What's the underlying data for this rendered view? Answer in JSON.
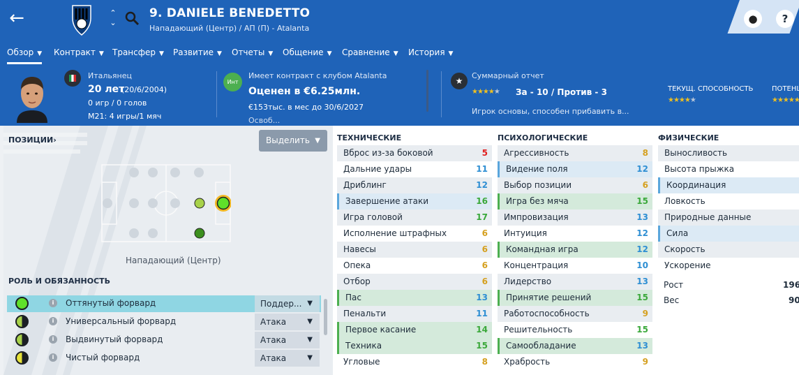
{
  "header": {
    "title": "9. DANIELE BENEDETTO",
    "subtitle": "Нападающий (Центр) / АП (П) - Atalanta",
    "help_label": "?"
  },
  "nav": {
    "tabs": [
      {
        "label": "Обзор",
        "active": true
      },
      {
        "label": "Контракт"
      },
      {
        "label": "Трансфер"
      },
      {
        "label": "Развитие"
      },
      {
        "label": "Отчеты"
      },
      {
        "label": "Общение"
      },
      {
        "label": "Сравнение"
      },
      {
        "label": "История"
      }
    ]
  },
  "info": {
    "nationality": "Итальянец",
    "age": "20 лет",
    "birth": "(20/6/2004)",
    "career": "0 игр / 0 голов",
    "youth": "M21: 4 игры/1 мяч",
    "contract_label": "Имеет контракт с клубом Atalanta",
    "badge": "Инт",
    "value": "Оценен в €6.25млн.",
    "wage": "€153тыс. в мес до 30/6/2027",
    "wage_more": "Освоб...",
    "report_title": "Суммарный отчет",
    "report_score": "За - 10 / Против - 3",
    "report_stars": 3.5,
    "report_summary": "Игрок основы, способен прибавить в...",
    "current_ability_label": "ТЕКУЩ. СПОСОБНОСТЬ",
    "current_ability_stars": 3.5,
    "potential_label": "ПОТЕНЦ",
    "potential_stars": 5
  },
  "left": {
    "positions_label": "ПОЗИЦИИ",
    "select_label": "Выделить",
    "position_name": "Нападающий (Центр)",
    "roles_label": "РОЛЬ И ОБЯЗАННОСТЬ",
    "roles": [
      {
        "name": "Оттянутый форвард",
        "duty": "Поддер...",
        "selected": true,
        "fill": "full"
      },
      {
        "name": "Универсальный форвард",
        "duty": "Атака",
        "fill": "half"
      },
      {
        "name": "Выдвинутый форвард",
        "duty": "Атака",
        "fill": "half"
      },
      {
        "name": "Чистый форвард",
        "duty": "Атака",
        "fill": "half-yellow"
      }
    ]
  },
  "attributes": {
    "technical_label": "ТЕХНИЧЕСКИЕ",
    "mental_label": "ПСИХОЛОГИЧЕСКИЕ",
    "physical_label": "ФИЗИЧЕСКИЕ",
    "technical": [
      {
        "name": "Вброс из-за боковой",
        "value": "5",
        "color": "red"
      },
      {
        "name": "Дальние удары",
        "value": "11",
        "color": "blue"
      },
      {
        "name": "Дриблинг",
        "value": "12",
        "color": "blue"
      },
      {
        "name": "Завершение атаки",
        "value": "16",
        "color": "green",
        "hl": "blue"
      },
      {
        "name": "Игра головой",
        "value": "17",
        "color": "green"
      },
      {
        "name": "Исполнение штрафных",
        "value": "6",
        "color": "orange"
      },
      {
        "name": "Навесы",
        "value": "6",
        "color": "orange"
      },
      {
        "name": "Опека",
        "value": "6",
        "color": "orange"
      },
      {
        "name": "Отбор",
        "value": "6",
        "color": "orange"
      },
      {
        "name": "Пас",
        "value": "13",
        "color": "blue",
        "hl": "green"
      },
      {
        "name": "Пенальти",
        "value": "11",
        "color": "blue"
      },
      {
        "name": "Первое касание",
        "value": "14",
        "color": "green",
        "hl": "green"
      },
      {
        "name": "Техника",
        "value": "15",
        "color": "green",
        "hl": "green"
      },
      {
        "name": "Угловые",
        "value": "8",
        "color": "orange"
      }
    ],
    "mental": [
      {
        "name": "Агрессивность",
        "value": "8",
        "color": "orange"
      },
      {
        "name": "Видение поля",
        "value": "12",
        "color": "blue",
        "hl": "blue"
      },
      {
        "name": "Выбор позиции",
        "value": "6",
        "color": "orange"
      },
      {
        "name": "Игра без мяча",
        "value": "15",
        "color": "green",
        "hl": "green"
      },
      {
        "name": "Импровизация",
        "value": "13",
        "color": "blue"
      },
      {
        "name": "Интуиция",
        "value": "12",
        "color": "blue"
      },
      {
        "name": "Командная игра",
        "value": "12",
        "color": "blue",
        "hl": "green"
      },
      {
        "name": "Концентрация",
        "value": "10",
        "color": "blue"
      },
      {
        "name": "Лидерство",
        "value": "13",
        "color": "blue"
      },
      {
        "name": "Принятие решений",
        "value": "15",
        "color": "green",
        "hl": "green"
      },
      {
        "name": "Работоспособность",
        "value": "9",
        "color": "orange"
      },
      {
        "name": "Решительность",
        "value": "15",
        "color": "green"
      },
      {
        "name": "Самообладание",
        "value": "13",
        "color": "blue",
        "hl": "green"
      },
      {
        "name": "Храбрость",
        "value": "9",
        "color": "orange"
      }
    ],
    "physical": [
      {
        "name": "Выносливость"
      },
      {
        "name": "Высота прыжка"
      },
      {
        "name": "Координация",
        "hl": "blue"
      },
      {
        "name": "Ловкость"
      },
      {
        "name": "Природные данные"
      },
      {
        "name": "Сила",
        "hl": "blue"
      },
      {
        "name": "Скорость"
      },
      {
        "name": "Ускорение"
      }
    ],
    "height_label": "Рост",
    "height_value": "196",
    "weight_label": "Вес",
    "weight_value": "90"
  },
  "colors": {
    "header_bg": "#1f63b8",
    "green": "#3aa83a",
    "blue": "#2f8fd3",
    "orange": "#d5a020",
    "red": "#e02020"
  }
}
